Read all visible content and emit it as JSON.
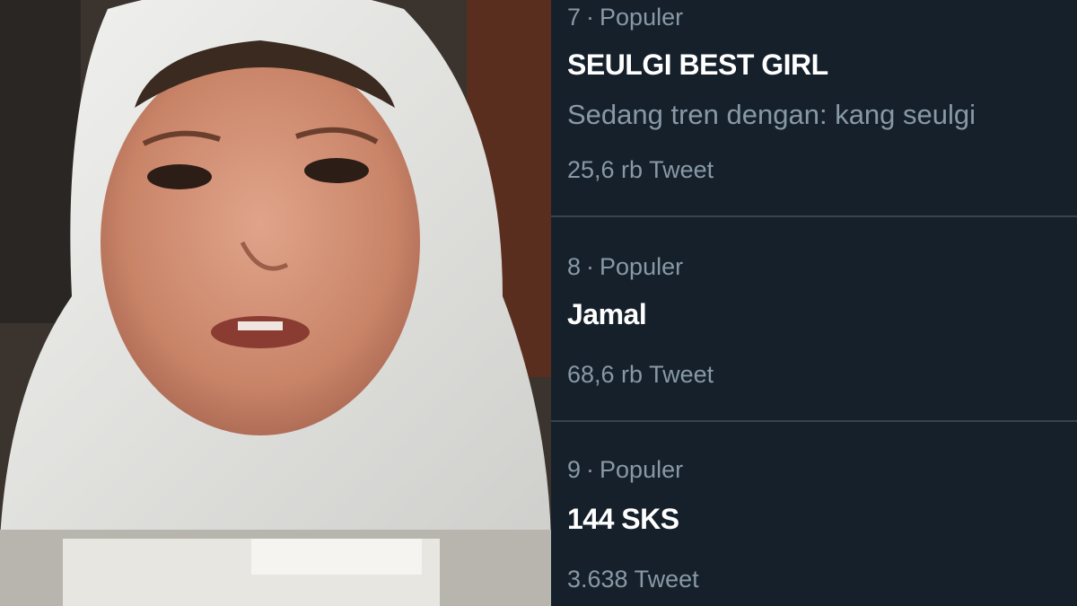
{
  "trends": [
    {
      "rank": "7",
      "separator": "·",
      "category": "Populer",
      "name": "SEULGI BEST GIRL",
      "context": "Sedang tren dengan: kang seulgi",
      "count": "25,6 rb Tweet"
    },
    {
      "rank": "8",
      "separator": "·",
      "category": "Populer",
      "name": "Jamal",
      "count": "68,6 rb Tweet"
    },
    {
      "rank": "9",
      "separator": "·",
      "category": "Populer",
      "name": "144 SKS",
      "count": "3.638 Tweet"
    }
  ],
  "colors": {
    "background": "#15202b",
    "primary_text": "#ffffff",
    "secondary_text": "#8899a6",
    "divider": "#38444d"
  }
}
